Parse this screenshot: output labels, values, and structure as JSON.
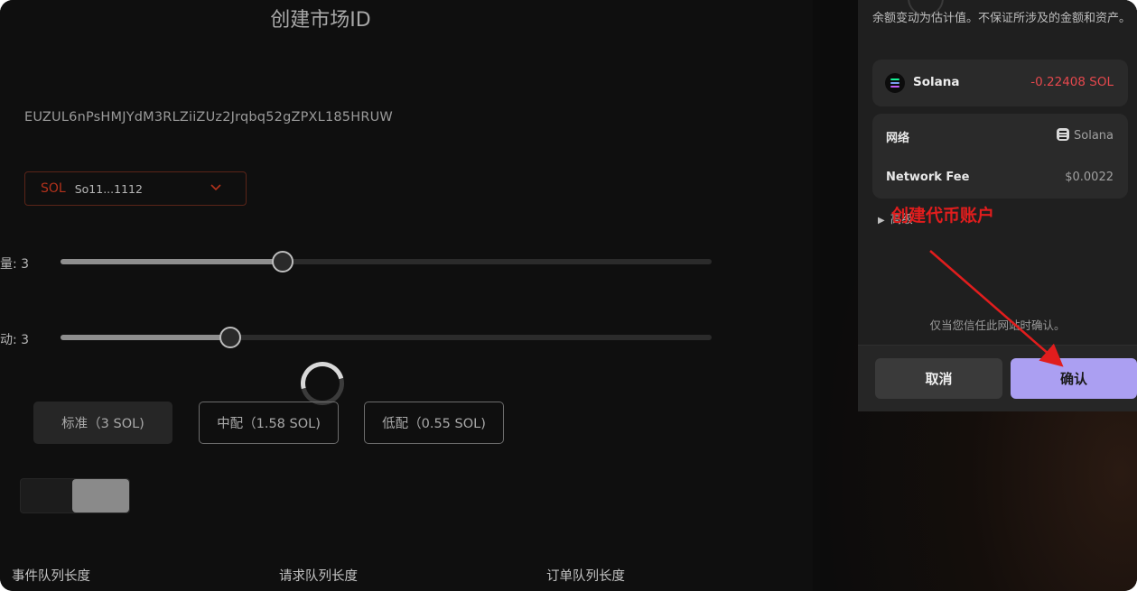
{
  "page": {
    "title": "创建市场ID",
    "market_id": "EUZUL6nPsHMJYdM3RLZiiZUz2Jrqbq52gZPXL185HRUW",
    "token_select": {
      "symbol": "SOL",
      "address": "So11...1112"
    },
    "sliders": [
      {
        "label": "量: 3",
        "value_fraction": 0.34
      },
      {
        "label": "动: 3",
        "value_fraction": 0.26
      }
    ],
    "options": [
      {
        "label": "标准（3 SOL)"
      },
      {
        "label": "中配（1.58 SOL)"
      },
      {
        "label": "低配（0.55 SOL)"
      }
    ],
    "field_labels": [
      "事件队列长度",
      "请求队列长度",
      "订单队列长度"
    ]
  },
  "wallet": {
    "notice": "余额变动为估计值。不保证所涉及的金额和资产。",
    "asset": {
      "name": "Solana",
      "change": "-0.22408 SOL"
    },
    "details": [
      {
        "label": "网络",
        "value": "Solana"
      },
      {
        "label": "Network Fee",
        "value": "$0.0022"
      }
    ],
    "advanced_label": "高级",
    "trust_note": "仅当您信任此网站时确认。",
    "cancel_label": "取消",
    "confirm_label": "确认"
  },
  "annotation": {
    "text": "创建代币账户",
    "color": "#e11d1d"
  },
  "colors": {
    "accent": "#ab9ff2",
    "negative": "#e5484d",
    "token": "#b2321c"
  },
  "icons": [
    "chevron-down-icon",
    "solana-logo-icon",
    "network-icon",
    "caret-right-icon",
    "loading-spinner-icon"
  ]
}
